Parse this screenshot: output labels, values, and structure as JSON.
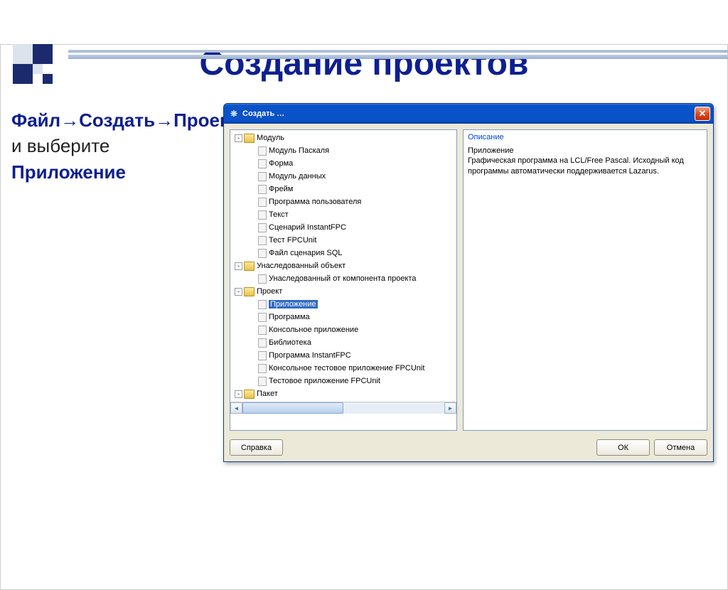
{
  "slide": {
    "title": "Создание проектов",
    "instruction_parts": {
      "p1": "Файл→Создать→Проект",
      "p2": " и выберите ",
      "p3": "Приложение"
    }
  },
  "dialog": {
    "title": "Создать …",
    "description_label": "Описание",
    "description_text": "Приложение\nГрафическая программа на LCL/Free Pascal. Исходный код программы автоматически поддерживается Lazarus.",
    "buttons": {
      "help": "Справка",
      "ok": "ОК",
      "cancel": "Отмена"
    },
    "tree": [
      {
        "label": "Модуль",
        "level": 0,
        "type": "folder",
        "expand": "-"
      },
      {
        "label": "Модуль Паскаля",
        "level": 1,
        "type": "file"
      },
      {
        "label": "Форма",
        "level": 1,
        "type": "file"
      },
      {
        "label": "Модуль данных",
        "level": 1,
        "type": "file"
      },
      {
        "label": "Фрейм",
        "level": 1,
        "type": "file"
      },
      {
        "label": "Программа пользователя",
        "level": 1,
        "type": "file"
      },
      {
        "label": "Текст",
        "level": 1,
        "type": "file"
      },
      {
        "label": "Сценарий InstantFPC",
        "level": 1,
        "type": "file"
      },
      {
        "label": "Тест FPCUnit",
        "level": 1,
        "type": "file"
      },
      {
        "label": "Файл сценария SQL",
        "level": 1,
        "type": "file"
      },
      {
        "label": "Унаследованный объект",
        "level": 0,
        "type": "folder",
        "expand": "-"
      },
      {
        "label": "Унаследованный от компонента проекта",
        "level": 1,
        "type": "file"
      },
      {
        "label": "Проект",
        "level": 0,
        "type": "folder",
        "expand": "-"
      },
      {
        "label": "Приложение",
        "level": 1,
        "type": "file",
        "selected": true
      },
      {
        "label": "Программа",
        "level": 1,
        "type": "file"
      },
      {
        "label": "Консольное приложение",
        "level": 1,
        "type": "file"
      },
      {
        "label": "Библиотека",
        "level": 1,
        "type": "file"
      },
      {
        "label": "Программа InstantFPC",
        "level": 1,
        "type": "file"
      },
      {
        "label": "Консольное тестовое приложение FPCUnit",
        "level": 1,
        "type": "file"
      },
      {
        "label": "Тестовое приложение FPCUnit",
        "level": 1,
        "type": "file"
      },
      {
        "label": "Пакет",
        "level": 0,
        "type": "folder",
        "expand": "-"
      }
    ]
  }
}
